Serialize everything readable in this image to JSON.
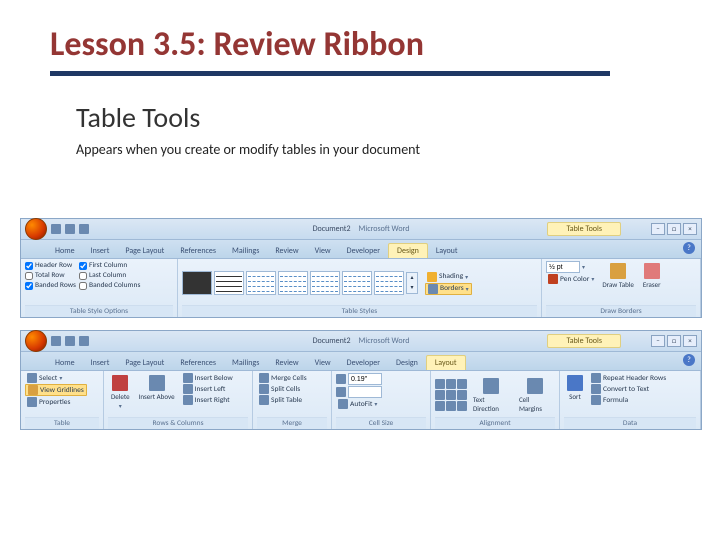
{
  "title": "Lesson 3.5: Review Ribbon",
  "subtitle": "Table Tools",
  "description": "Appears when you create or modify  tables in your document",
  "word": {
    "document_name": "Document2",
    "app_name": "Microsoft Word",
    "context_tab_title": "Table Tools",
    "tabs": [
      "Home",
      "Insert",
      "Page Layout",
      "References",
      "Mailings",
      "Review",
      "View",
      "Developer"
    ],
    "context_tabs": [
      "Design",
      "Layout"
    ]
  },
  "design_ribbon": {
    "options": {
      "left": [
        "Header Row",
        "Total Row",
        "Banded Rows"
      ],
      "right": [
        "First Column",
        "Last Column",
        "Banded Columns"
      ],
      "group_label": "Table Style Options"
    },
    "styles_label": "Table Styles",
    "shading_label": "Shading",
    "borders_label": "Borders",
    "draw": {
      "pen_weight": "½ pt",
      "pen_color": "Pen Color",
      "draw": "Draw Table",
      "eraser": "Eraser",
      "group_label": "Draw Borders"
    }
  },
  "layout_ribbon": {
    "table_group": {
      "select": "Select",
      "gridlines": "View Gridlines",
      "properties": "Properties",
      "label": "Table"
    },
    "rows_cols": {
      "delete": "Delete",
      "insert_above": "Insert Above",
      "insert_below": "Insert Below",
      "insert_left": "Insert Left",
      "insert_right": "Insert Right",
      "label": "Rows & Columns"
    },
    "merge": {
      "merge": "Merge Cells",
      "split_cells": "Split Cells",
      "split_table": "Split Table",
      "label": "Merge"
    },
    "cell_size": {
      "height": "0.19\"",
      "width": "",
      "autofit": "AutoFit",
      "label": "Cell Size"
    },
    "alignment": {
      "direction": "Text Direction",
      "margins": "Cell Margins",
      "label": "Alignment"
    },
    "data": {
      "sort": "Sort",
      "repeat": "Repeat Header Rows",
      "convert": "Convert to Text",
      "formula": "Formula",
      "label": "Data"
    }
  }
}
